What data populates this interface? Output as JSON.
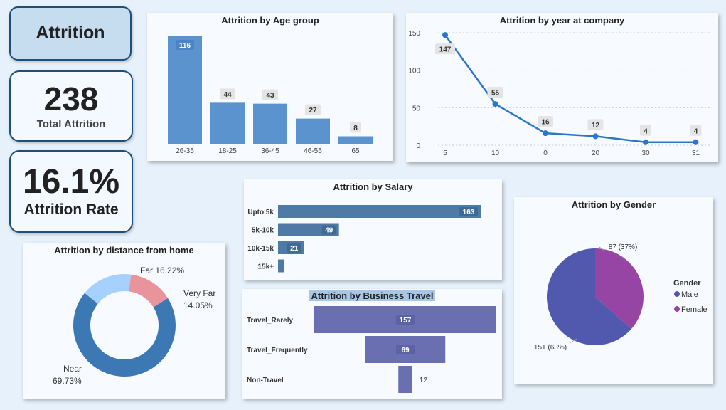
{
  "kpis": {
    "title": "Attrition",
    "total_value": "238",
    "total_label": "Total Attrition",
    "rate_value": "16.1%",
    "rate_label": "Attrition Rate"
  },
  "colors": {
    "bar_blue": "#5b93cf",
    "line_blue": "#2a77c9",
    "salary_bar": "#4e7aa5",
    "travel_bar": "#6a6fb1",
    "donut_near": "#3c78b4",
    "donut_far": "#a6d1ff",
    "donut_very_far": "#e9939c",
    "pie_male": "#5059ae",
    "pie_female": "#9645a5",
    "label_box": "#e4e4e4"
  },
  "chart_data": [
    {
      "id": "age",
      "type": "bar",
      "title": "Attrition by Age group",
      "categories": [
        "26-35",
        "18-25",
        "36-45",
        "46-55",
        "65"
      ],
      "values": [
        116,
        44,
        43,
        27,
        8
      ],
      "ylim": [
        0,
        116
      ]
    },
    {
      "id": "years",
      "type": "line",
      "title": "Attrition by year at company",
      "categories": [
        "5",
        "10",
        "0",
        "20",
        "30",
        "31"
      ],
      "values": [
        147,
        55,
        16,
        12,
        4,
        4
      ],
      "y_ticks": [
        0,
        50,
        100,
        150
      ],
      "ylim": [
        0,
        150
      ],
      "grid": true
    },
    {
      "id": "salary",
      "type": "bar",
      "orientation": "horizontal",
      "title": "Attrition by Salary",
      "categories": [
        "Upto 5k",
        "5k-10k",
        "10k-15k",
        "15k+"
      ],
      "values": [
        163,
        49,
        21,
        5
      ],
      "labels": [
        "163",
        "49",
        "21",
        ""
      ]
    },
    {
      "id": "distance",
      "type": "pie",
      "variant": "donut",
      "title": "Attrition by distance from home",
      "slices": [
        {
          "name": "Near",
          "value": 69.73,
          "label": "69.73%"
        },
        {
          "name": "Far",
          "value": 16.22,
          "label": "16.22%"
        },
        {
          "name": "Very Far",
          "value": 14.05,
          "label": "14.05%"
        }
      ]
    },
    {
      "id": "travel",
      "type": "bar",
      "variant": "funnel",
      "title": "Attrition by Business Travel",
      "categories": [
        "Travel_Rarely",
        "Travel_Frequently",
        "Non-Travel"
      ],
      "values": [
        157,
        69,
        12
      ]
    },
    {
      "id": "gender",
      "type": "pie",
      "title": "Attrition by Gender",
      "legend_title": "Gender",
      "legend_position": "right",
      "slices": [
        {
          "name": "Male",
          "value": 151,
          "label": "151 (63%)"
        },
        {
          "name": "Female",
          "value": 87,
          "label": "87 (37%)"
        }
      ]
    }
  ]
}
